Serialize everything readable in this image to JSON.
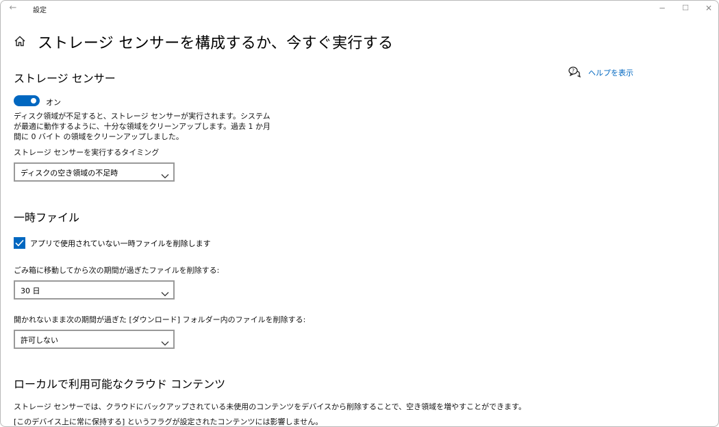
{
  "window": {
    "app_title": "設定",
    "back_glyph": "←",
    "minimize_glyph": "─",
    "maximize_glyph": "☐",
    "close_glyph": "✕"
  },
  "header": {
    "title": "ストレージ センサーを構成するか、今すぐ実行する"
  },
  "storage_sense": {
    "heading": "ストレージ センサー",
    "toggle_state": "オン",
    "description": "ディスク領域が不足すると、ストレージ センサーが実行されます。システムが最適に動作するように、十分な領域をクリーンアップします。過去 1 か月間に 0 バイト の領域をクリーンアップしました。",
    "timing_label": "ストレージ センサーを実行するタイミング",
    "timing_value": "ディスクの空き領域の不足時"
  },
  "temp_files": {
    "heading": "一時ファイル",
    "checkbox_label": "アプリで使用されていない一時ファイルを削除します",
    "checkbox_checked": true,
    "recycle_label": "ごみ箱に移動してから次の期間が過ぎたファイルを削除する:",
    "recycle_value": "30 日",
    "downloads_label": "開かれないまま次の期間が過ぎた [ダウンロード] フォルダー内のファイルを削除する:",
    "downloads_value": "許可しない"
  },
  "cloud": {
    "heading": "ローカルで利用可能なクラウド コンテンツ",
    "line1": "ストレージ センサーでは、クラウドにバックアップされている未使用のコンテンツをデバイスから削除することで、空き領域を増やすことができます。",
    "line2": "[このデバイス上に常に保持する] というフラグが設定されたコンテンツには影響しません。"
  },
  "help": {
    "link": "ヘルプを表示",
    "icon": "help-chat-icon"
  },
  "colors": {
    "accent": "#0067c0",
    "select_border": "#999999"
  }
}
